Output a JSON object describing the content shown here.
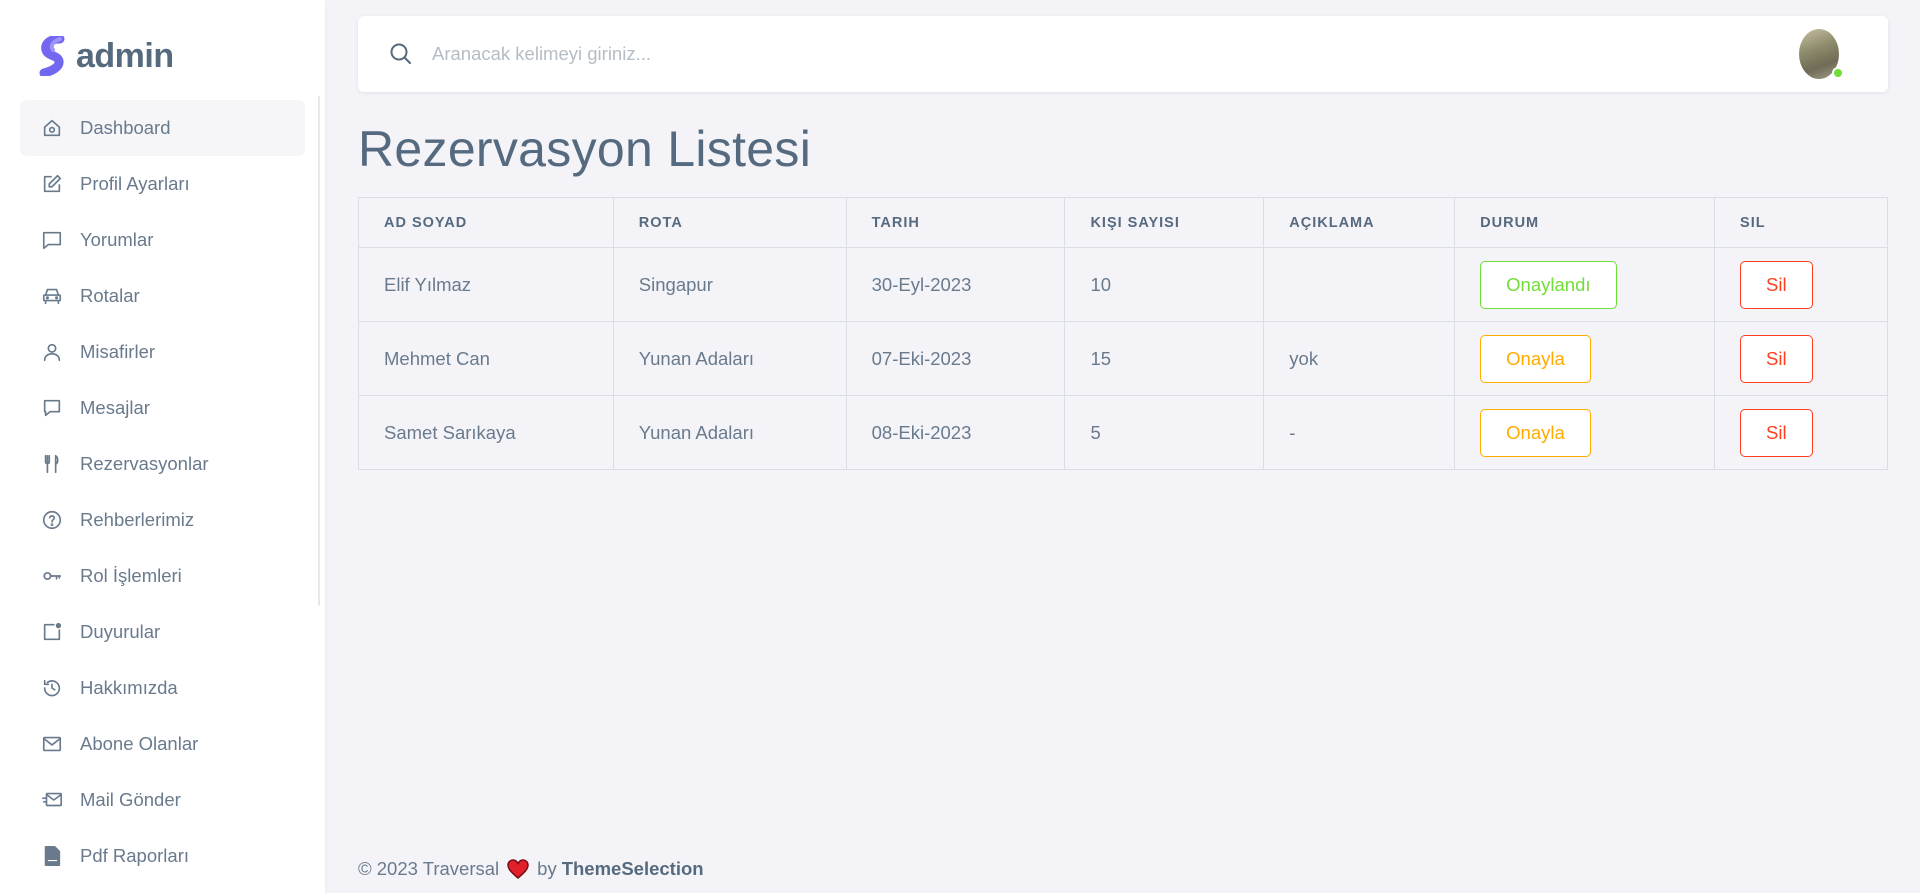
{
  "brand": {
    "name": "admin",
    "accent": "#7367f0"
  },
  "sidebar": {
    "items": [
      {
        "label": "Dashboard",
        "icon": "home-icon"
      },
      {
        "label": "Profil Ayarları",
        "icon": "edit-icon"
      },
      {
        "label": "Yorumlar",
        "icon": "comment-icon"
      },
      {
        "label": "Rotalar",
        "icon": "car-icon"
      },
      {
        "label": "Misafirler",
        "icon": "user-icon"
      },
      {
        "label": "Mesajlar",
        "icon": "message-icon"
      },
      {
        "label": "Rezervasyonlar",
        "icon": "restaurant-icon"
      },
      {
        "label": "Rehberlerimiz",
        "icon": "help-circle-icon"
      },
      {
        "label": "Rol İşlemleri",
        "icon": "key-icon"
      },
      {
        "label": "Duyurular",
        "icon": "notification-icon"
      },
      {
        "label": "Hakkımızda",
        "icon": "history-icon"
      },
      {
        "label": "Abone Olanlar",
        "icon": "envelope-icon"
      },
      {
        "label": "Mail Gönder",
        "icon": "mail-send-icon"
      },
      {
        "label": "Pdf Raporları",
        "icon": "pdf-icon"
      }
    ]
  },
  "navbar": {
    "search_placeholder": "Aranacak kelimeyi giriniz...",
    "avatar_status_color": "#71dd37"
  },
  "page": {
    "title": "Rezervasyon Listesi"
  },
  "table": {
    "headers": [
      "AD SOYAD",
      "ROTA",
      "TARIH",
      "KIŞI SAYISI",
      "AÇIKLAMA",
      "DURUM",
      "SIL"
    ],
    "rows": [
      {
        "name": "Elif Yılmaz",
        "route": "Singapur",
        "date": "30-Eyl-2023",
        "count": "10",
        "note": "",
        "status": "Onaylandı",
        "status_type": "success",
        "delete": "Sil"
      },
      {
        "name": "Mehmet Can",
        "route": "Yunan Adaları",
        "date": "07-Eki-2023",
        "count": "15",
        "note": "yok",
        "status": "Onayla",
        "status_type": "warning",
        "delete": "Sil"
      },
      {
        "name": "Samet Sarıkaya",
        "route": "Yunan Adaları",
        "date": "08-Eki-2023",
        "count": "5",
        "note": "-",
        "status": "Onayla",
        "status_type": "warning",
        "delete": "Sil"
      }
    ]
  },
  "footer": {
    "copyright": "© 2023 Traversal",
    "by": "by",
    "link": "ThemeSelection",
    "heart_color": "#e0202b"
  }
}
